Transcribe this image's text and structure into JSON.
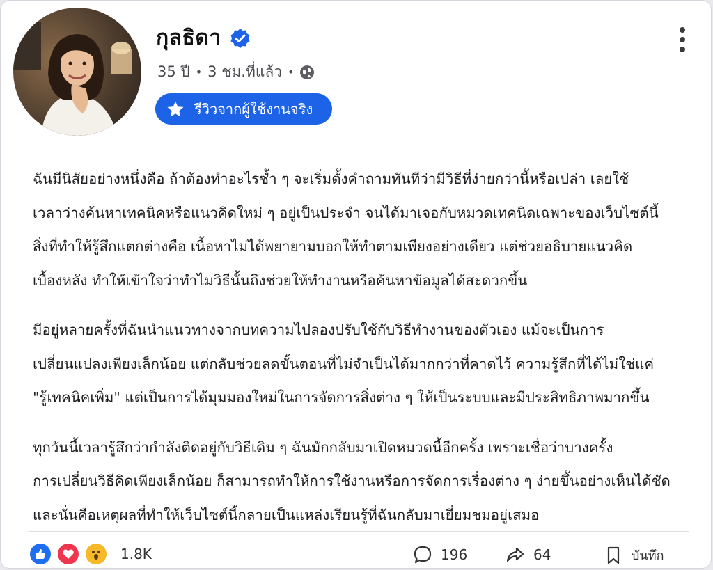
{
  "post": {
    "author": "กุลธิดา",
    "age": "35 ปี",
    "time": "3 ชม.ที่แล้ว",
    "separator": "•",
    "badge_label": "รีวิวจากผู้ใช้งานจริง",
    "paragraphs": [
      [
        "ฉันมีนิสัยอย่างหนึ่งคือ ถ้าต้องทำอะไรซ้ำ ๆ จะเริ่มตั้งคำถามทันทีว่ามีวิธีที่ง่ายกว่านี้หรือเปล่า เลยใช้",
        "เวลาว่างค้นหาเทคนิคหรือแนวคิดใหม่ ๆ อยู่เป็นประจำ จนได้มาเจอกับหมวดเทคนิดเฉพาะของเว็บไซต์นี้",
        "สิ่งที่ทำให้รู้สึกแตกต่างคือ เนื้อหาไม่ได้พยายามบอกให้ทำตามเพียงอย่างเดียว แต่ช่วยอธิบายแนวคิด",
        "เบื้องหลัง ทำให้เข้าใจว่าทำไมวิธีนั้นถึงช่วยให้ทำงานหรือค้นหาข้อมูลได้สะดวกขึ้น"
      ],
      [
        "มีอยู่หลายครั้งที่ฉันนำแนวทางจากบทความไปลองปรับใช้กับวิธีทำงานของตัวเอง แม้จะเป็นการ",
        "เปลี่ยนแปลงเพียงเล็กน้อย แต่กลับช่วยลดขั้นตอนที่ไม่จำเป็นได้มากกว่าที่คาดไว้ ความรู้สึกที่ได้ไม่ใช่แค่",
        "\"รู้เทคนิคเพิ่ม\" แต่เป็นการได้มุมมองใหม่ในการจัดการสิ่งต่าง ๆ ให้เป็นระบบและมีประสิทธิภาพมากขึ้น"
      ],
      [
        "ทุกวันนี้เวลารู้สึกว่ากำลังติดอยู่กับวิธีเดิม ๆ ฉันมักกลับมาเปิดหมวดนี้อีกครั้ง เพราะเชื่อว่าบางครั้ง",
        "การเปลี่ยนวิธีคิดเพียงเล็กน้อย ก็สามารถทำให้การใช้งานหรือการจัดการเรื่องต่าง ๆ ง่ายขึ้นอย่างเห็นได้ชัด",
        "และนั่นคือเหตุผลที่ทำให้เว็บไซต์นี้กลายเป็นแหล่งเรียนรู้ที่ฉันกลับมาเยี่ยมชมอยู่เสมอ"
      ]
    ]
  },
  "footer": {
    "reactions": [
      "like-icon",
      "heart-icon",
      "wow-icon"
    ],
    "reaction_count": "1.8K",
    "comments": "196",
    "shares": "64",
    "save_label": "บันทึก"
  },
  "colors": {
    "badge": "#1d63e8",
    "verified": "#1d63e8",
    "like": "#1d6ef0",
    "heart": "#f0364f",
    "wow": "#f7b928"
  }
}
